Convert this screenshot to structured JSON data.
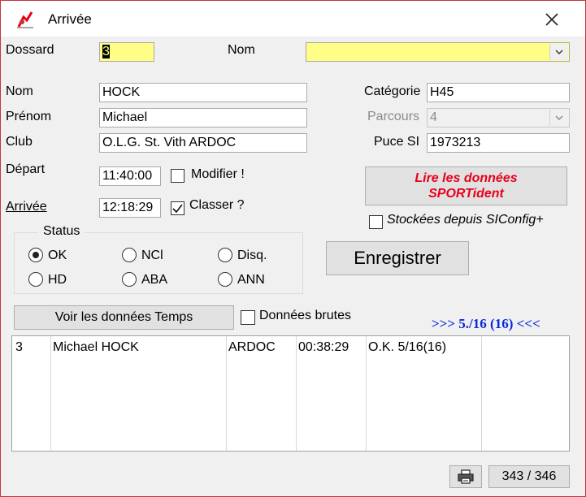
{
  "window": {
    "title": "Arrivée"
  },
  "search": {
    "dossard_label": "Dossard",
    "dossard_value": "3",
    "nom_label": "Nom",
    "nom_value": ""
  },
  "form": {
    "nom_label": "Nom",
    "nom_value": "HOCK",
    "prenom_label": "Prénom",
    "prenom_value": "Michael",
    "club_label": "Club",
    "club_value": "O.L.G. St. Vith ARDOC",
    "depart_label": "Départ",
    "depart_value": "11:40:00",
    "modifier_label": "Modifier !",
    "arrivee_label": "Arrivée",
    "arrivee_value": "12:18:29",
    "classer_label": "Classer ?",
    "categorie_label": "Catégorie",
    "categorie_value": "H45",
    "parcours_label": "Parcours",
    "parcours_value": "4",
    "puce_label": "Puce SI",
    "puce_value": "1973213"
  },
  "sportident": {
    "read_line1": "Lire les données",
    "read_line2": "SPORTident",
    "stored_label": "Stockées depuis SIConfig+"
  },
  "status": {
    "title": "Status",
    "options": [
      "OK",
      "NCl",
      "Disq.",
      "HD",
      "ABA",
      "ANN"
    ],
    "selected": "OK"
  },
  "actions": {
    "save_label": "Enregistrer",
    "voir_label": "Voir les données Temps",
    "raw_label": "Données brutes"
  },
  "ranking": {
    "text": ">>> 5./16 (16) <<<"
  },
  "results": {
    "rows": [
      {
        "bib": "3",
        "name": "Michael HOCK",
        "club": "ARDOC",
        "time": "00:38:29",
        "result": "O.K. 5/16(16)"
      }
    ]
  },
  "footer": {
    "counter": "343 / 346"
  },
  "colors": {
    "accent_red": "#e8001c",
    "link_blue": "#0a29d8",
    "highlight": "#ffff88"
  }
}
